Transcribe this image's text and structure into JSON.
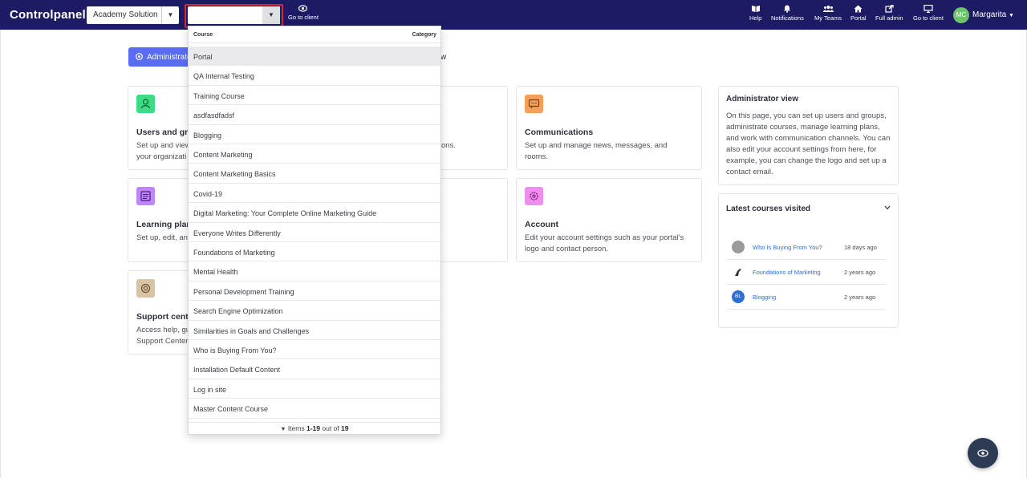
{
  "app": {
    "brand": "Controlpanel"
  },
  "topbar": {
    "academy_select": "Academy Solution",
    "course_select_value": "",
    "go_to_client": "Go to client",
    "help": "Help",
    "notifications": "Notifications",
    "my_teams": "My Teams",
    "portal": "Portal",
    "full_admin": "Full admin",
    "go_to_client_right": "Go to client",
    "user_initials": "MC",
    "user_name": "Margarita"
  },
  "tabs": {
    "administrator": "Administrator view",
    "hidden_tail": "w"
  },
  "cards": {
    "users": {
      "title": "Users and groups",
      "desc_line1": "Set up and view",
      "desc_line2": "your organizati"
    },
    "courses_tail": {
      "desc": "ons."
    },
    "communications": {
      "title": "Communications",
      "desc": "Set up and manage news, messages, and rooms."
    },
    "learning_plans": {
      "title": "Learning plans",
      "desc": "Set up, edit, an"
    },
    "account": {
      "title": "Account",
      "desc": "Edit your account settings such as your portal's logo and contact person."
    },
    "support": {
      "title": "Support center",
      "desc_line1": "Access help, gu",
      "desc_line2": "Support Center"
    }
  },
  "sidebar": {
    "admin_view_title": "Administrator view",
    "admin_view_text": "On this page, you can set up users and groups, administrate courses, manage learning plans, and work with communication channels. You can also edit your account settings from here, for example, you can change the logo and set up a contact email.",
    "latest_title": "Latest courses visited",
    "latest": [
      {
        "name": "Who Is Buying From You?",
        "when": "18 days ago",
        "avatar": ""
      },
      {
        "name": "Foundations of Marketing",
        "when": "2 years ago",
        "avatar": ""
      },
      {
        "name": "Blogging",
        "when": "2 years ago",
        "avatar": "BL"
      }
    ]
  },
  "dropdown": {
    "col_course": "Course",
    "col_category": "Category",
    "items": [
      "Portal",
      "QA Internal Testing",
      "Training Course",
      "asdfasdfadsf",
      "Blogging",
      "Content Marketing",
      "Content Marketing Basics",
      "Covid-19",
      "Digital Marketing: Your Complete Online Marketing Guide",
      "Everyone Writes Differently",
      "Foundations of Marketing",
      "Mental Health",
      "Personal Development Training",
      "Search Engine Optimization",
      "Similarities in Goals and Challenges",
      "Who is Buying From You?",
      "Installation Default Content",
      "Log in site",
      "Master Content Course"
    ],
    "selected_index": 0,
    "footer": {
      "prefix": "Items",
      "range": "1-19",
      "middle": "out of",
      "total": "19"
    }
  },
  "colors": {
    "topbar": "#1c1b63",
    "accent_tab": "#5b6cf4",
    "users_icon": "#3ddc84",
    "communications_icon": "#f5a05a",
    "learning_icon": "#c084fc",
    "account_icon": "#f08ef0",
    "support_icon": "#d8c3a5",
    "highlight_border": "#d9263b",
    "fab": "#2e3b55"
  }
}
